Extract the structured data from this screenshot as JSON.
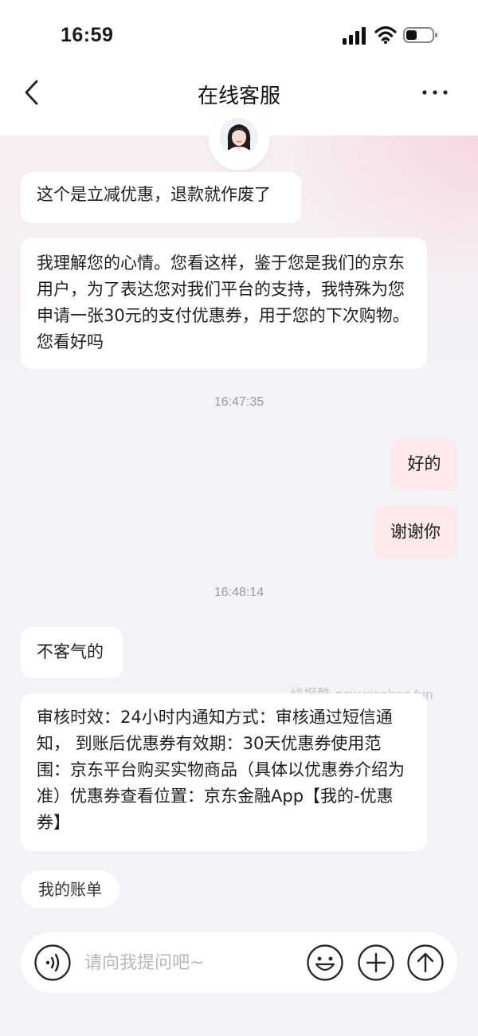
{
  "status_bar": {
    "time": "16:59"
  },
  "nav": {
    "title": "在线客服"
  },
  "messages": [
    {
      "side": "agent",
      "text": "这个是立减优惠，退款就作废了"
    },
    {
      "side": "agent",
      "text": "我理解您的心情。您看这样，鉴于您是我们的京东用户，为了表达您对我们平台的支持，我特殊为您申请一张30元的支付优惠券，用于您的下次购物。您看好吗"
    },
    {
      "side": "time",
      "text": "16:47:35"
    },
    {
      "side": "user",
      "text": "好的"
    },
    {
      "side": "user",
      "text": "谢谢你"
    },
    {
      "side": "time",
      "text": "16:48:14"
    },
    {
      "side": "agent",
      "text": "不客气的"
    },
    {
      "side": "agent",
      "text": "审核时效：24小时内通知方式：审核通过短信通知， 到账后优惠券有效期：30天优惠券使用范围：京东平台购买实物商品（具体以优惠券介绍为准）优惠券查看位置：京东金融App【我的-优惠券】"
    }
  ],
  "watermark": "线报酷-new.xianbao.fun",
  "quick_reply": {
    "label": "我的账单"
  },
  "input": {
    "placeholder": "请向我提问吧~"
  },
  "colors": {
    "user_bubble": "#fde8ea",
    "agent_bubble": "#ffffff",
    "background": "#f3f2f7"
  }
}
